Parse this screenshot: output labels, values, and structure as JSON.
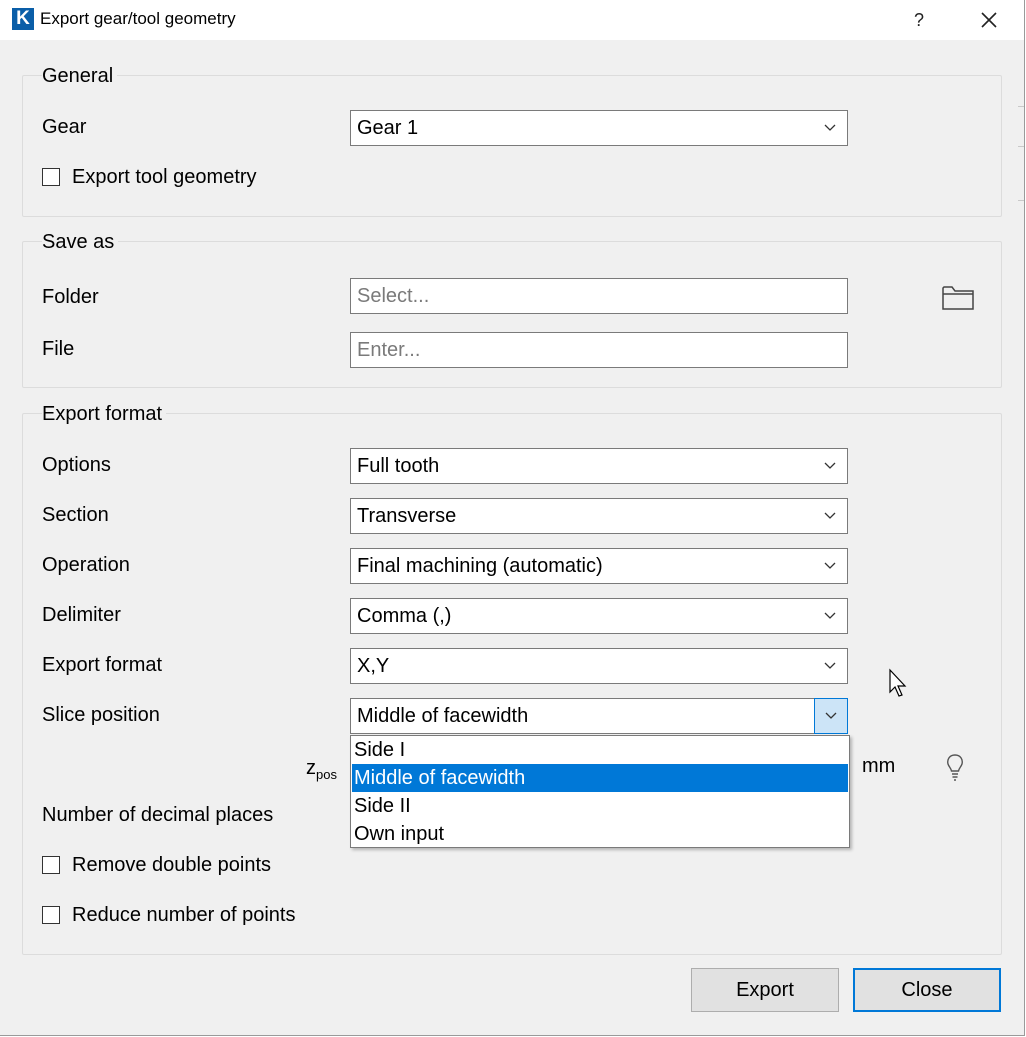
{
  "window": {
    "title": "Export gear/tool geometry",
    "logo_letter": "K",
    "help_label": "?",
    "close_label": "✕"
  },
  "general": {
    "title": "General",
    "gear_label": "Gear",
    "gear_value": "Gear 1",
    "export_tool_label": "Export tool geometry"
  },
  "save_as": {
    "title": "Save as",
    "folder_label": "Folder",
    "folder_placeholder": "Select...",
    "file_label": "File",
    "file_placeholder": "Enter..."
  },
  "export_format": {
    "title": "Export format",
    "options_label": "Options",
    "options_value": "Full tooth",
    "section_label": "Section",
    "section_value": "Transverse",
    "operation_label": "Operation",
    "operation_value": "Final machining (automatic)",
    "delimiter_label": "Delimiter",
    "delimiter_value": "Comma (,)",
    "format_label": "Export format",
    "format_value": "X,Y",
    "slice_label": "Slice position",
    "slice_value": "Middle of facewidth",
    "slice_options": [
      "Side I",
      "Middle of facewidth",
      "Side II",
      "Own input"
    ],
    "zpos_symbol": "z",
    "zpos_subscript": "pos",
    "zpos_unit": "mm",
    "decimal_label": "Number of decimal places",
    "remove_double_label": "Remove double points",
    "reduce_points_label": "Reduce number of points"
  },
  "buttons": {
    "export": "Export",
    "close": "Close"
  },
  "icons": {
    "folder": "folder-open-icon",
    "bulb": "lightbulb-icon",
    "chevron": "chevron-down-icon"
  },
  "colors": {
    "accent": "#0078d7",
    "logo": "#0a5ea8"
  }
}
